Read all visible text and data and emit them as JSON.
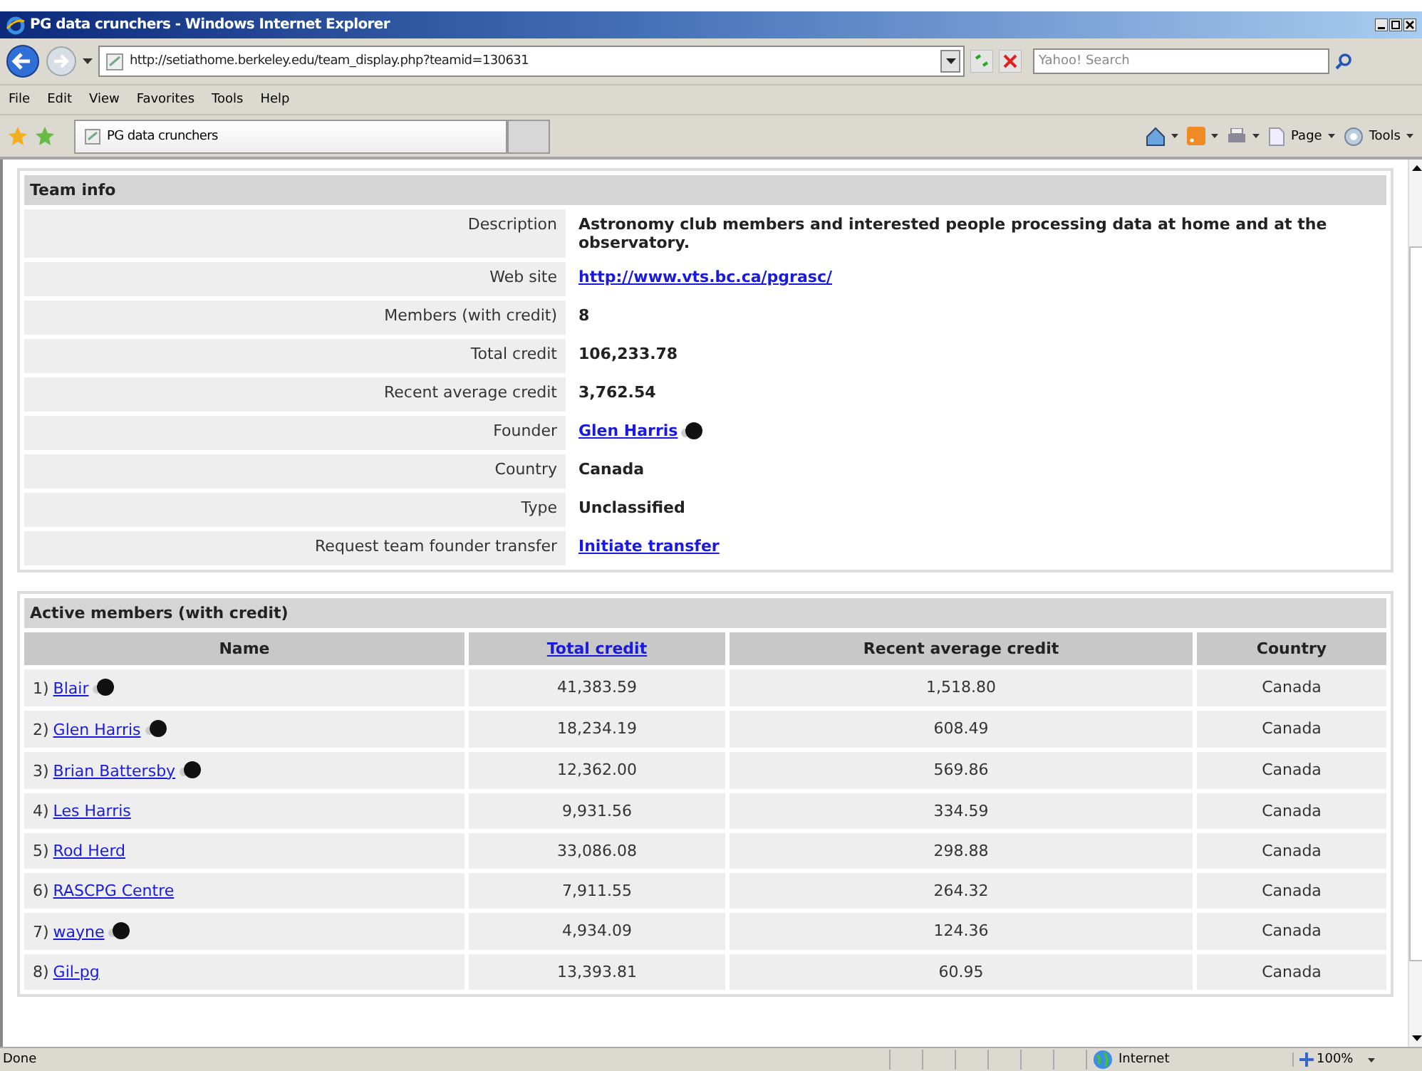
{
  "window": {
    "title": "PG data crunchers - Windows Internet Explorer"
  },
  "address_bar": {
    "url": "http://setiathome.berkeley.edu/team_display.php?teamid=130631"
  },
  "search": {
    "placeholder": "Yahoo! Search"
  },
  "menu": [
    "File",
    "Edit",
    "View",
    "Favorites",
    "Tools",
    "Help"
  ],
  "tabs": [
    {
      "label": "PG data crunchers",
      "selected": true
    }
  ],
  "command_bar": [
    {
      "kind": "home"
    },
    {
      "kind": "feed"
    },
    {
      "kind": "print"
    },
    {
      "kind": "page",
      "label": "Page"
    },
    {
      "kind": "tools",
      "label": "Tools"
    }
  ],
  "team_info": {
    "title": "Team info",
    "rows": [
      {
        "label": "Description",
        "value": "Astronomy club members and interested people processing data at home and at the observatory.",
        "kind": "text"
      },
      {
        "label": "Web site",
        "value": "http://www.vts.bc.ca/pgrasc/",
        "kind": "link"
      },
      {
        "label": "Members (with credit)",
        "value": "8",
        "kind": "text"
      },
      {
        "label": "Total credit",
        "value": "106,233.78",
        "kind": "text"
      },
      {
        "label": "Recent average credit",
        "value": "3,762.54",
        "kind": "text"
      },
      {
        "label": "Founder",
        "value": "Glen Harris",
        "kind": "user"
      },
      {
        "label": "Country",
        "value": "Canada",
        "kind": "text"
      },
      {
        "label": "Type",
        "value": "Unclassified",
        "kind": "text"
      },
      {
        "label": "Request team founder transfer",
        "value": "Initiate transfer",
        "kind": "link"
      }
    ]
  },
  "members": {
    "title": "Active members (with credit)",
    "columns": [
      {
        "label": "Name",
        "kind": "text"
      },
      {
        "label": "Total credit",
        "kind": "link"
      },
      {
        "label": "Recent average credit",
        "kind": "text"
      },
      {
        "label": "Country",
        "kind": "text"
      }
    ],
    "rows": [
      {
        "rank": "1)",
        "name": "Blair",
        "profile": true,
        "total_credit": "41,383.59",
        "recent_average_credit": "1,518.80",
        "country": "Canada"
      },
      {
        "rank": "2)",
        "name": "Glen Harris",
        "profile": true,
        "total_credit": "18,234.19",
        "recent_average_credit": "608.49",
        "country": "Canada"
      },
      {
        "rank": "3)",
        "name": "Brian Battersby",
        "profile": true,
        "total_credit": "12,362.00",
        "recent_average_credit": "569.86",
        "country": "Canada"
      },
      {
        "rank": "4)",
        "name": "Les Harris",
        "profile": false,
        "total_credit": "9,931.56",
        "recent_average_credit": "334.59",
        "country": "Canada"
      },
      {
        "rank": "5)",
        "name": "Rod Herd",
        "profile": false,
        "total_credit": "33,086.08",
        "recent_average_credit": "298.88",
        "country": "Canada"
      },
      {
        "rank": "6)",
        "name": "RASCPG Centre",
        "profile": false,
        "total_credit": "7,911.55",
        "recent_average_credit": "264.32",
        "country": "Canada"
      },
      {
        "rank": "7)",
        "name": "wayne",
        "profile": true,
        "total_credit": "4,934.09",
        "recent_average_credit": "124.36",
        "country": "Canada"
      },
      {
        "rank": "8)",
        "name": "Gil-pg",
        "profile": false,
        "total_credit": "13,393.81",
        "recent_average_credit": "60.95",
        "country": "Canada"
      }
    ]
  },
  "status_bar": {
    "text": "Done",
    "zone": "Internet",
    "zoom": "100%"
  }
}
